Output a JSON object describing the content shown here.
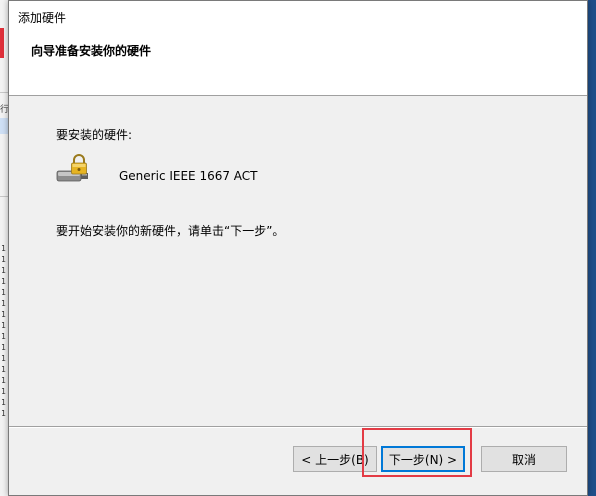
{
  "dialog": {
    "title": "添加硬件",
    "header_title": "向导准备安装你的硬件",
    "hardware_label": "要安装的硬件:",
    "device_name": "Generic IEEE 1667 ACT",
    "device_icon": "usb-lock-icon",
    "instruction": "要开始安装你的新硬件，请单击“下一步”。"
  },
  "buttons": {
    "back_label": "< 上一步(B)",
    "next_label": "下一步(N) >",
    "cancel_label": "取消"
  },
  "background": {
    "glyph": "行",
    "row_digits": [
      "1",
      "1",
      "1",
      "1",
      "1",
      "1",
      "1",
      "1",
      "1",
      "1",
      "1",
      "1",
      "1",
      "1",
      "1",
      "1"
    ]
  },
  "colors": {
    "highlight": "#e33b45",
    "focus": "#0078d7"
  }
}
